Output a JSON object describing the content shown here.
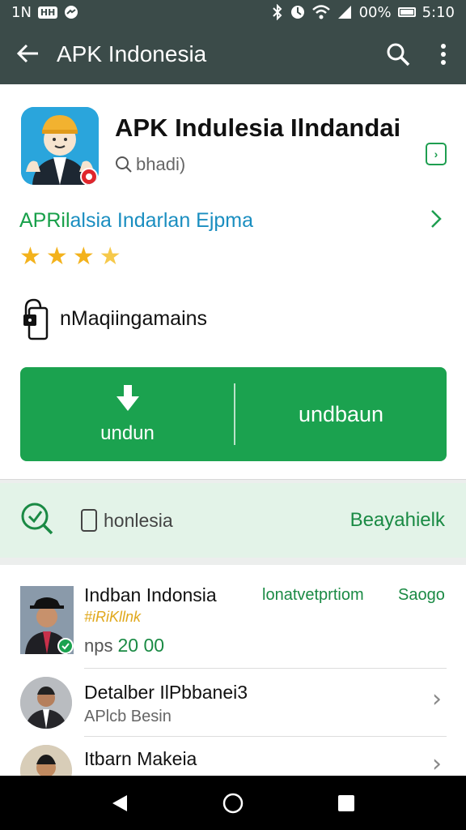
{
  "status_bar": {
    "left_text": "1N",
    "left_badge": "HH",
    "battery_pct": "00%",
    "time": "5:10"
  },
  "app_bar": {
    "title": "APK Indonesia"
  },
  "app_header": {
    "title": "APK Indulesia  Ilndandai",
    "subtitle": "bhadi)",
    "publisher_part1": "APRil",
    "publisher_part2": "alsia Indarlan Ejpma",
    "rating_stars": 4
  },
  "permissions": {
    "label": "nMaqiingamains"
  },
  "download_button": {
    "left_label": "undun",
    "right_label": "undbaun"
  },
  "info_band": {
    "text": "honlesia",
    "action": "Beayahielk"
  },
  "list": {
    "items": [
      {
        "title": "Indban Indonsia",
        "tag": "#iRiKllnk",
        "price_label": "nps",
        "price_value": "20  00",
        "col1": "lonatvetprtiom",
        "col2": "Saogo"
      },
      {
        "title": "Detalber IlPbbanei3",
        "subtitle": "APlcb Besin"
      },
      {
        "title": "Itbarn Makeia"
      }
    ]
  },
  "colors": {
    "app_bar": "#3b4b49",
    "accent_green": "#1ba24f",
    "publisher_blue": "#1a8ec0",
    "star": "#f3b21c",
    "band_bg": "#e3f3e8"
  }
}
